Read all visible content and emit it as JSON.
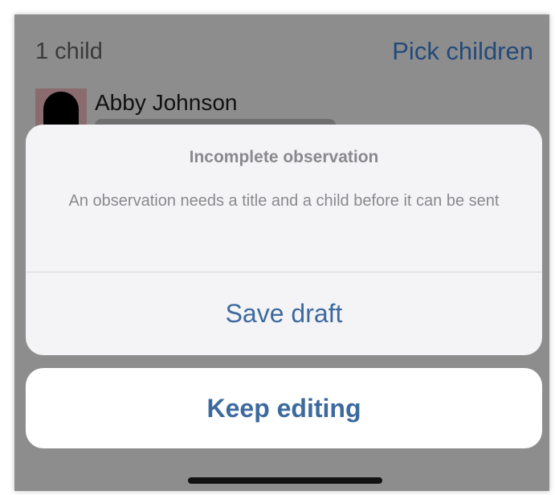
{
  "header": {
    "child_count": "1 child",
    "pick_children_label": "Pick children"
  },
  "child": {
    "name": "Abby Johnson"
  },
  "alert": {
    "title": "Incomplete observation",
    "message": "An observation needs a title and a child before it can be sent",
    "save_draft_label": "Save draft",
    "keep_editing_label": "Keep editing"
  },
  "colors": {
    "accent": "#3d6a9e",
    "overlay": "#8d8d8d",
    "sheet_background": "#f4f4f6",
    "muted_text": "#8a8a8e"
  }
}
